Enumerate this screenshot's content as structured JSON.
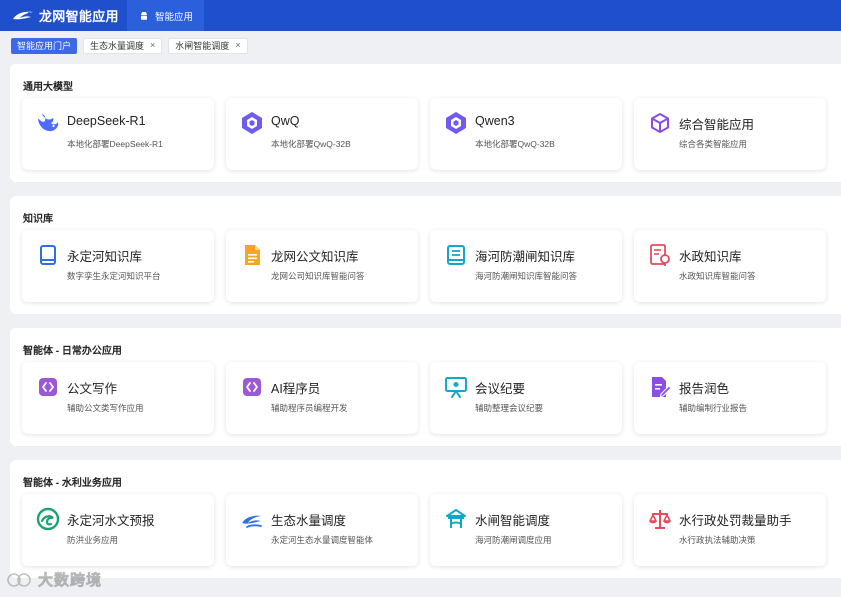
{
  "app": {
    "title": "龙网智能应用"
  },
  "nav": {
    "active_item": "智能应用"
  },
  "tabs": [
    {
      "label": "智能应用门户",
      "closable": false
    },
    {
      "label": "生态水量调度",
      "closable": true
    },
    {
      "label": "水闸智能调度",
      "closable": true
    }
  ],
  "close_glyph": "×",
  "sections": [
    {
      "title": "通用大模型",
      "cards": [
        {
          "title": "DeepSeek-R1",
          "desc": "本地化部署DeepSeek-R1",
          "icon": "deepseek-whale-icon"
        },
        {
          "title": "QwQ",
          "desc": "本地化部署QwQ-32B",
          "icon": "qwen-logo-icon"
        },
        {
          "title": "Qwen3",
          "desc": "本地化部署QwQ-32B",
          "icon": "qwen-logo-icon"
        },
        {
          "title": "综合智能应用",
          "desc": "综合各类智能应用",
          "icon": "cube-icon"
        }
      ]
    },
    {
      "title": "知识库",
      "cards": [
        {
          "title": "永定河知识库",
          "desc": "数字孪生永定河知识平台",
          "icon": "book-icon"
        },
        {
          "title": "龙网公文知识库",
          "desc": "龙网公司知识库智能问答",
          "icon": "document-icon"
        },
        {
          "title": "海河防潮闸知识库",
          "desc": "海河防潮闸知识库智能问答",
          "icon": "manual-icon"
        },
        {
          "title": "水政知识库",
          "desc": "水政知识库智能问答",
          "icon": "law-document-icon"
        }
      ]
    },
    {
      "title": "智能体 - 日常办公应用",
      "cards": [
        {
          "title": "公文写作",
          "desc": "辅助公文类写作应用",
          "icon": "code-brackets-icon"
        },
        {
          "title": "AI程序员",
          "desc": "辅助程序员编程开发",
          "icon": "code-brackets-icon"
        },
        {
          "title": "会议纪要",
          "desc": "辅助整理会议纪要",
          "icon": "presentation-board-icon"
        },
        {
          "title": "报告润色",
          "desc": "辅助编制行业报告",
          "icon": "edit-document-icon"
        }
      ]
    },
    {
      "title": "智能体 - 水利业务应用",
      "cards": [
        {
          "title": "永定河水文预报",
          "desc": "防洪业务应用",
          "icon": "swirl-icon"
        },
        {
          "title": "生态水量调度",
          "desc": "永定河生态水量调度智能体",
          "icon": "water-wave-icon"
        },
        {
          "title": "水闸智能调度",
          "desc": "海河防潮闸调度应用",
          "icon": "sluice-gate-icon"
        },
        {
          "title": "水行政处罚裁量助手",
          "desc": "水行政执法辅助决策",
          "icon": "scales-icon"
        }
      ]
    }
  ],
  "watermark": {
    "text": "大数跨境"
  },
  "colors": {
    "header": "#1f4fcc",
    "active_nav": "#2b5fdc",
    "active_tab": "#3d69e6",
    "page_bg": "#eef0f4"
  }
}
